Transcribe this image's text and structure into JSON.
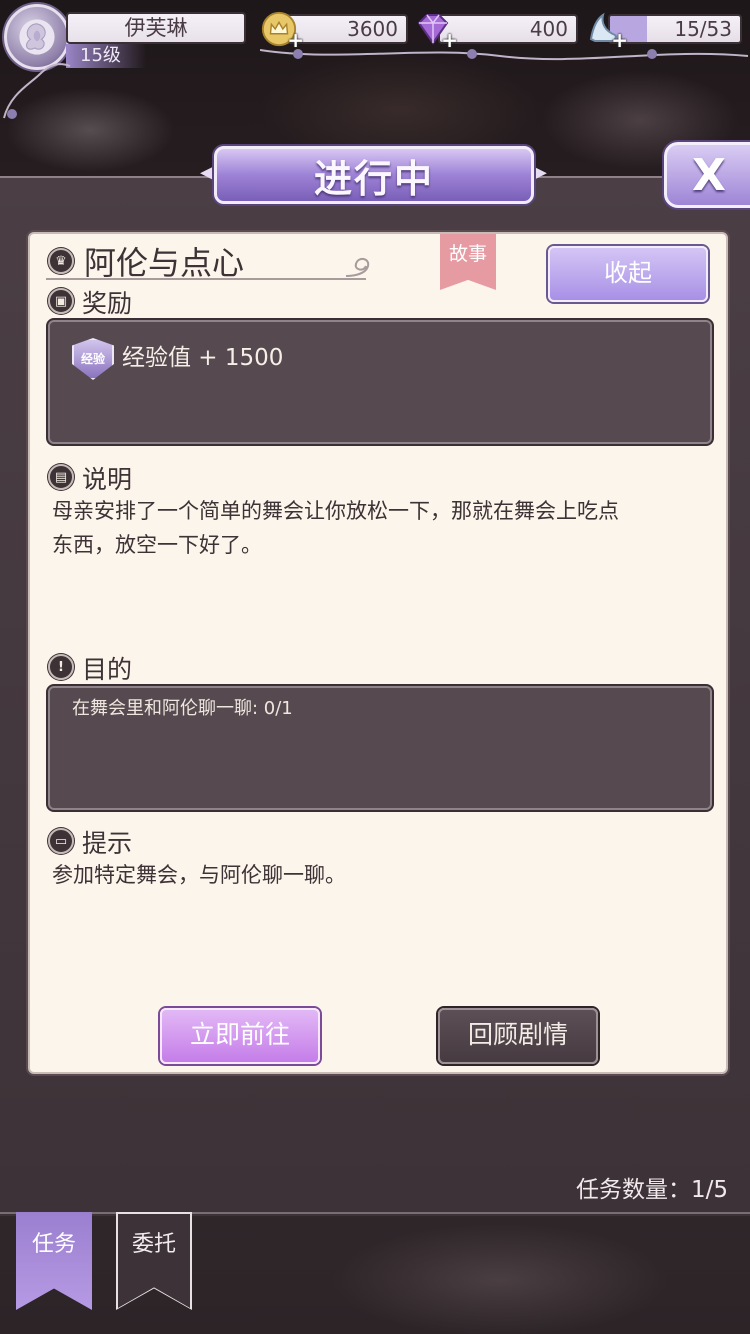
{
  "player": {
    "name": "伊芙琳",
    "level": "15级"
  },
  "resources": {
    "coins": "3600",
    "gems": "400",
    "stamina": "15/53",
    "stamina_fraction": 0.283
  },
  "header": {
    "title": "进行中",
    "close_label": "X"
  },
  "quest": {
    "title": "阿伦与点心",
    "tag": "故事",
    "collapse_label": "收起",
    "reward": {
      "section_title": "奖励",
      "badge_text": "经验",
      "text": "经验值 + 1500"
    },
    "description": {
      "section_title": "说明",
      "line1": "母亲安排了一个简单的舞会让你放松一下，那就在舞会上吃点",
      "line2": "东西，放空一下好了。"
    },
    "objective": {
      "section_title": "目的",
      "text": "在舞会里和阿伦聊一聊: 0/1"
    },
    "hint": {
      "section_title": "提示",
      "text": "参加特定舞会，与阿伦聊一聊。"
    },
    "go_label": "立即前往",
    "review_label": "回顾剧情"
  },
  "quest_count": "任务数量：1/5",
  "tabs": [
    {
      "label": "任务",
      "active": true
    },
    {
      "label": "委托",
      "active": false
    }
  ],
  "colors": {
    "accent_purple": "#9d82d6",
    "card_background": "#fcf5eb",
    "dark_box": "#564a50",
    "story_tag": "#e69aa2"
  }
}
